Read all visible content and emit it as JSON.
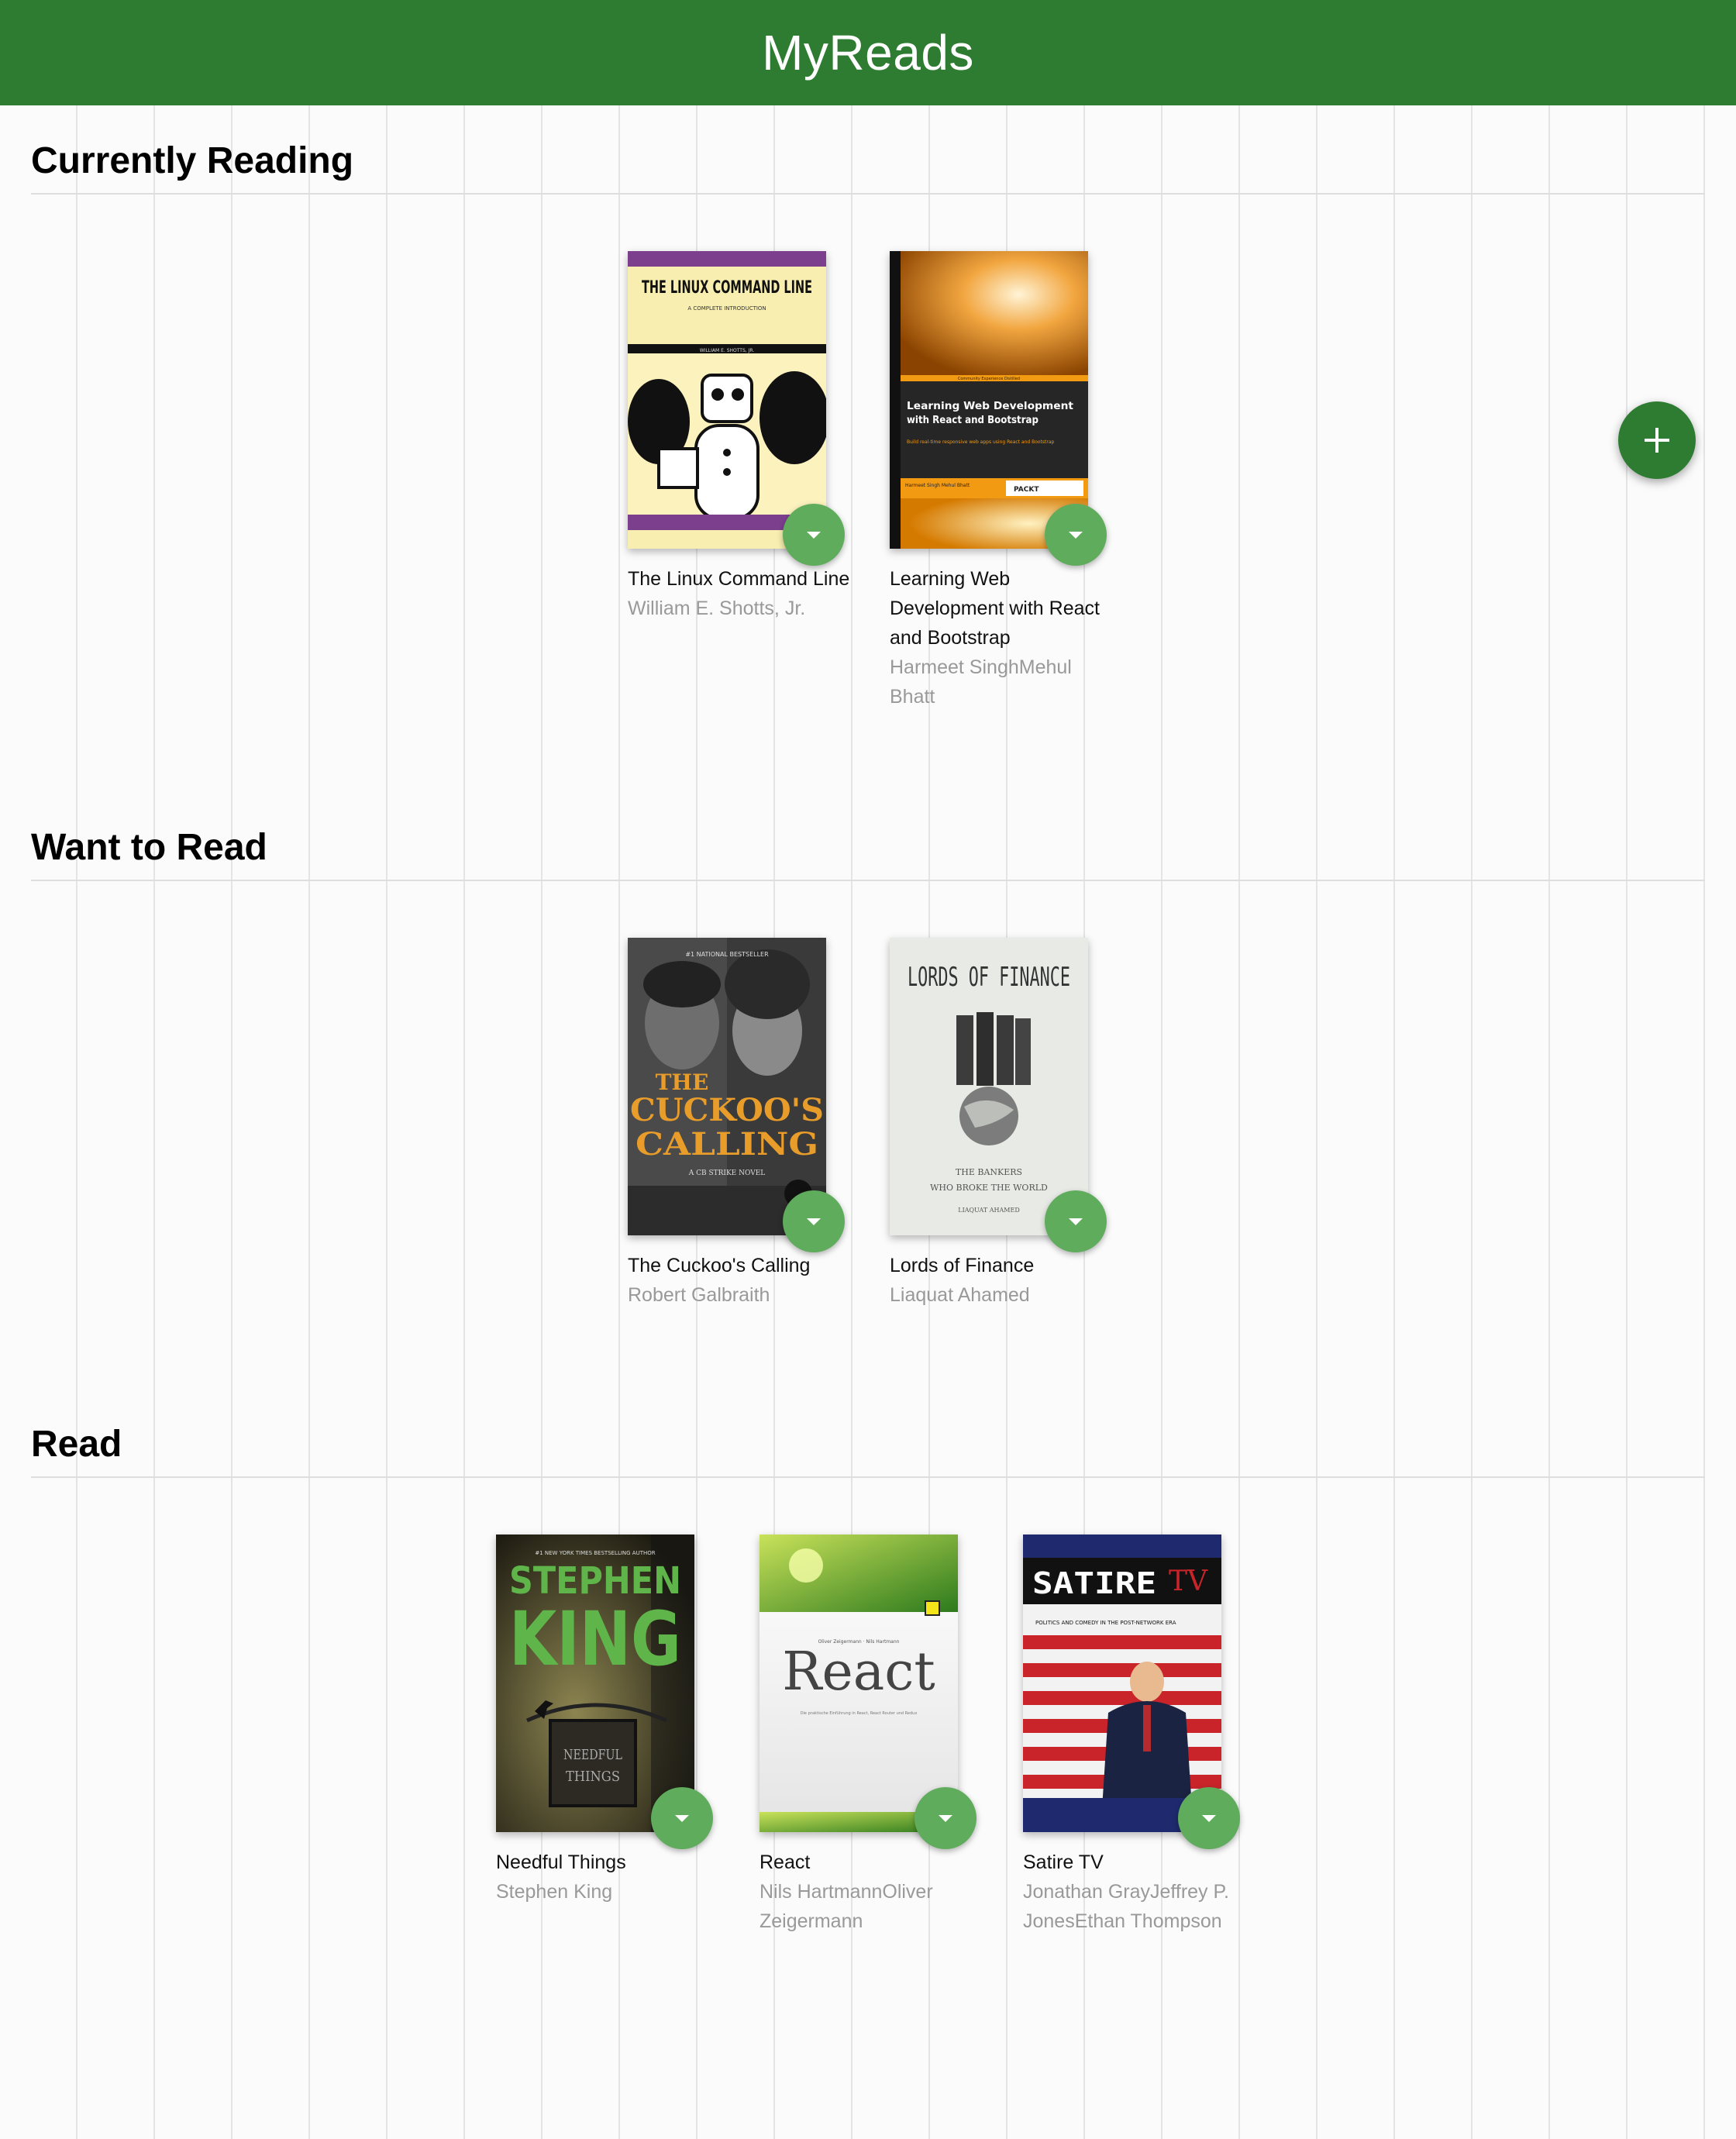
{
  "app": {
    "title": "MyReads"
  },
  "shelves": [
    {
      "title": "Currently Reading",
      "books": [
        {
          "title": "The Linux Command Line",
          "authors": "William E. Shotts, Jr.",
          "cover": {
            "heading": "THE LINUX COMMAND LINE",
            "subtitle": "A COMPLETE INTRODUCTION",
            "author": "WILLIAM E. SHOTTS, JR."
          }
        },
        {
          "title": "Learning Web Development with React and Bootstrap",
          "authors": "Harmeet SinghMehul Bhatt",
          "cover": {
            "series": "Community Experience Distilled",
            "heading": "Learning Web Development with React and Bootstrap",
            "tagline": "Build real-time responsive web apps using React and Bootstrap",
            "author": "Harmeet Singh Mehul Bhatt",
            "publisher": "PACKT"
          }
        }
      ]
    },
    {
      "title": "Want to Read",
      "books": [
        {
          "title": "The Cuckoo's Calling",
          "authors": "Robert Galbraith",
          "cover": {
            "banner": "#1 NATIONAL BESTSELLER",
            "heading1": "THE",
            "heading2": "CUCKOO'S",
            "heading3": "CALLING",
            "subtitle": "A CB STRIKE NOVEL"
          }
        },
        {
          "title": "Lords of Finance",
          "authors": "Liaquat Ahamed",
          "cover": {
            "heading": "LORDS OF FINANCE",
            "subtitle1": "THE BANKERS",
            "subtitle2": "WHO BROKE THE WORLD",
            "author": "LIAQUAT AHAMED"
          }
        }
      ]
    },
    {
      "title": "Read",
      "books": [
        {
          "title": "Needful Things",
          "authors": "Stephen King",
          "cover": {
            "banner": "#1 NEW YORK TIMES BESTSELLING AUTHOR",
            "author1": "STEPHEN",
            "author2": "KING",
            "sign": "NEEDFUL THINGS"
          }
        },
        {
          "title": "React",
          "authors": "Nils HartmannOliver Zeigermann",
          "cover": {
            "author": "Oliver Zeigermann · Nils Hartmann",
            "heading": "React",
            "tagline": "Die praktische Einführung in React, React Router und Redux"
          }
        },
        {
          "title": "Satire TV",
          "authors": "Jonathan GrayJeffrey P. JonesEthan Thompson",
          "cover": {
            "heading1": "SATIRE",
            "heading2": "TV",
            "subtitle": "POLITICS AND COMEDY IN THE POST-NETWORK ERA"
          }
        }
      ]
    }
  ],
  "colors": {
    "header": "#2e7c31",
    "changer": "#60ac5d",
    "add_button": "#2e7c31"
  },
  "icons": {
    "changer": "triangle-down-icon",
    "add": "plus-icon"
  }
}
